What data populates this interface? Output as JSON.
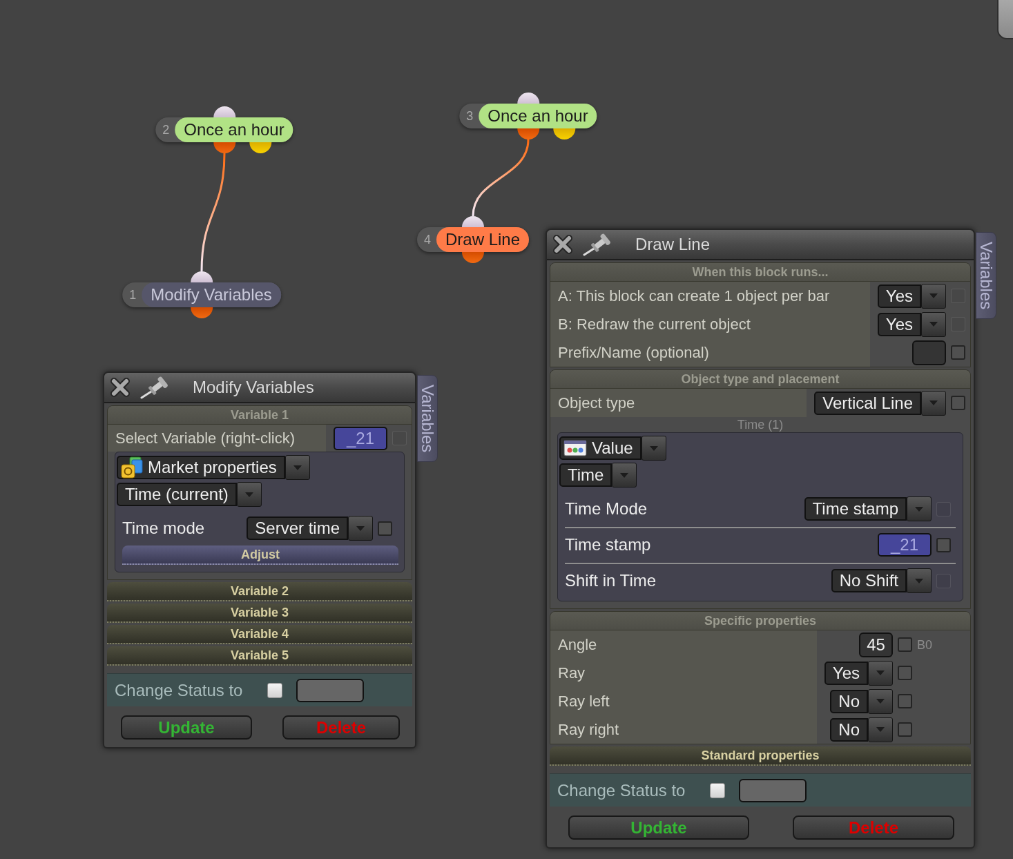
{
  "canvas": {
    "flows": [
      {
        "nodes": [
          {
            "kind": "trigger",
            "number": "2",
            "label": "Once an hour",
            "selected": false
          },
          {
            "kind": "action",
            "number": "1",
            "label": "Modify Variables",
            "selected": false
          }
        ]
      },
      {
        "nodes": [
          {
            "kind": "trigger",
            "number": "3",
            "label": "Once an hour",
            "selected": false
          },
          {
            "kind": "action",
            "number": "4",
            "label": "Draw Line",
            "selected": true
          }
        ]
      }
    ]
  },
  "windows": [
    {
      "title": "Modify Variables",
      "side_tab": "Variables",
      "sections": [
        {
          "title": "Variable 1",
          "expanded": true,
          "rows": [
            {
              "kind": "variable",
              "label": "Select Variable (right-click)",
              "value": "_21",
              "checkbox": {
                "checked": false,
                "disabled": true
              }
            }
          ],
          "group": [
            {
              "kind": "market",
              "value": "Market properties"
            },
            {
              "kind": "dropdown",
              "value": "Time (current)"
            },
            {
              "kind": "dropdown",
              "label": "Time mode",
              "value": "Server time",
              "checkbox": {
                "checked": false,
                "disabled": false
              }
            },
            {
              "kind": "button",
              "label": "Adjust"
            }
          ]
        },
        {
          "title": "Variable 2",
          "expanded": false
        },
        {
          "title": "Variable 3",
          "expanded": false
        },
        {
          "title": "Variable 4",
          "expanded": false
        },
        {
          "title": "Variable 5",
          "expanded": false
        }
      ],
      "status": {
        "label": "Change Status to",
        "checked": false
      },
      "buttons": [
        {
          "kind": "update",
          "label": "Update"
        },
        {
          "kind": "delete",
          "label": "Delete"
        }
      ]
    },
    {
      "title": "Draw Line",
      "side_tab": "Variables",
      "sections": [
        {
          "title": "When this block runs...",
          "expanded": true,
          "rows": [
            {
              "kind": "dropdown",
              "label": "A: This block can create 1 object per bar",
              "value": "Yes",
              "checkbox": {
                "checked": false,
                "disabled": true
              }
            },
            {
              "kind": "dropdown",
              "label": "B: Redraw the current object",
              "value": "Yes",
              "checkbox": {
                "checked": false,
                "disabled": true
              }
            },
            {
              "kind": "input",
              "label": "Prefix/Name (optional)",
              "checkbox": {
                "checked": false,
                "disabled": false
              }
            }
          ]
        },
        {
          "title": "Object type and placement",
          "expanded": true,
          "rows": [
            {
              "kind": "dropdown",
              "label": "Object type",
              "value": "Vertical Line",
              "checkbox": {
                "checked": false,
                "disabled": false
              }
            }
          ],
          "caption": "Time (1)",
          "group": [
            {
              "kind": "constant",
              "value": "Value"
            },
            {
              "kind": "dropdown",
              "value": "Time"
            },
            {
              "kind": "dropdown",
              "label": "Time Mode",
              "value": "Time stamp",
              "checkbox": {
                "checked": false,
                "disabled": true
              }
            },
            {
              "kind": "variable",
              "label": "Time stamp",
              "value": "_21",
              "checkbox": {
                "checked": false,
                "disabled": false
              },
              "rule_above": true
            },
            {
              "kind": "dropdown",
              "label": "Shift in Time",
              "value": "No Shift",
              "checkbox": {
                "checked": false,
                "disabled": true
              },
              "rule_above": true
            }
          ]
        },
        {
          "title": "Specific properties",
          "expanded": true,
          "rows": [
            {
              "kind": "input",
              "label": "Angle",
              "value": "45",
              "checkbox": {
                "checked": false,
                "disabled": false
              },
              "suffix": "B0"
            },
            {
              "kind": "dropdown",
              "label": "Ray",
              "value": "Yes",
              "checkbox": {
                "checked": false,
                "disabled": false
              }
            },
            {
              "kind": "dropdown",
              "label": "Ray left",
              "value": "No",
              "checkbox": {
                "checked": false,
                "disabled": false
              }
            },
            {
              "kind": "dropdown",
              "label": "Ray right",
              "value": "No",
              "checkbox": {
                "checked": false,
                "disabled": false
              }
            }
          ]
        },
        {
          "title": "Standard properties",
          "expanded": false
        }
      ],
      "status": {
        "label": "Change Status to",
        "checked": false
      },
      "buttons": [
        {
          "kind": "update",
          "label": "Update"
        },
        {
          "kind": "delete",
          "label": "Delete"
        }
      ]
    }
  ]
}
